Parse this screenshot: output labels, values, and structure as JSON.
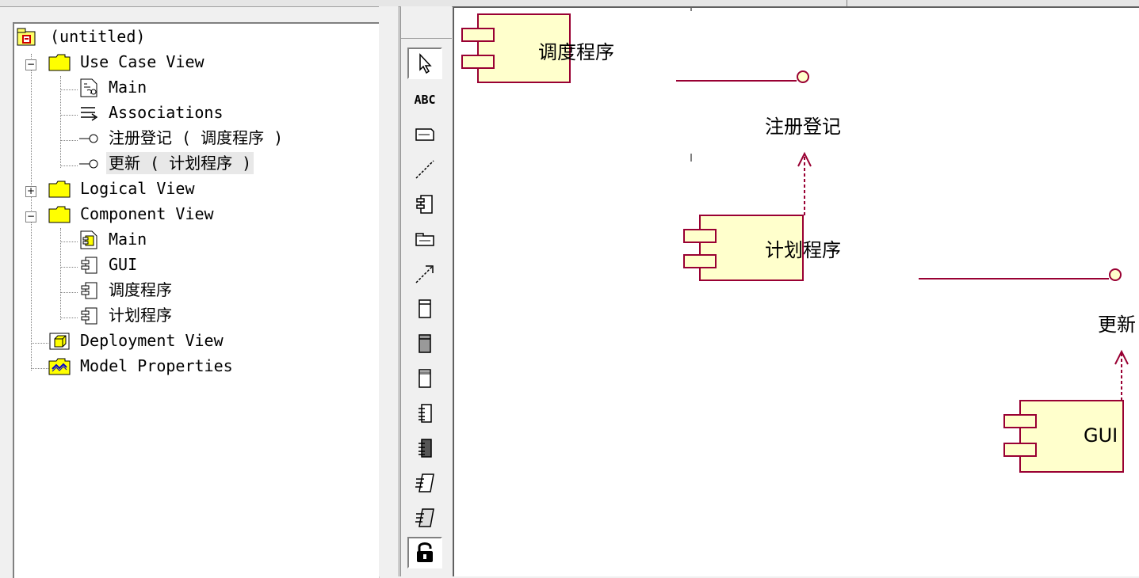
{
  "browser": {
    "root": "(untitled)",
    "use_case_view": {
      "label": "Use Case View",
      "items": [
        "Main",
        "Associations",
        "注册登记 ( 调度程序 )",
        "更新 ( 计划程序 )"
      ]
    },
    "logical_view": "Logical View",
    "component_view": {
      "label": "Component View",
      "items": [
        "Main",
        "GUI",
        "调度程序",
        "计划程序"
      ]
    },
    "deployment_view": "Deployment View",
    "model_properties": "Model Properties",
    "selected_item": "更新 ( 计划程序 )"
  },
  "toolbox": {
    "text_tool": "ABC",
    "tools": [
      "selection-arrow",
      "text-box",
      "note",
      "anchor-note",
      "component",
      "package",
      "dependency",
      "subprogram-spec",
      "subprogram-body",
      "main-program",
      "package-spec",
      "package-body",
      "task-spec",
      "task-body",
      "lock"
    ]
  },
  "diagram": {
    "components": [
      "调度程序",
      "计划程序",
      "GUI"
    ],
    "interfaces": [
      "注册登记",
      "更新"
    ]
  },
  "colors": {
    "component_fill": "#ffffcc",
    "component_stroke": "#990033",
    "dependency_stroke": "#990033",
    "folder_yellow": "#ffff00"
  }
}
